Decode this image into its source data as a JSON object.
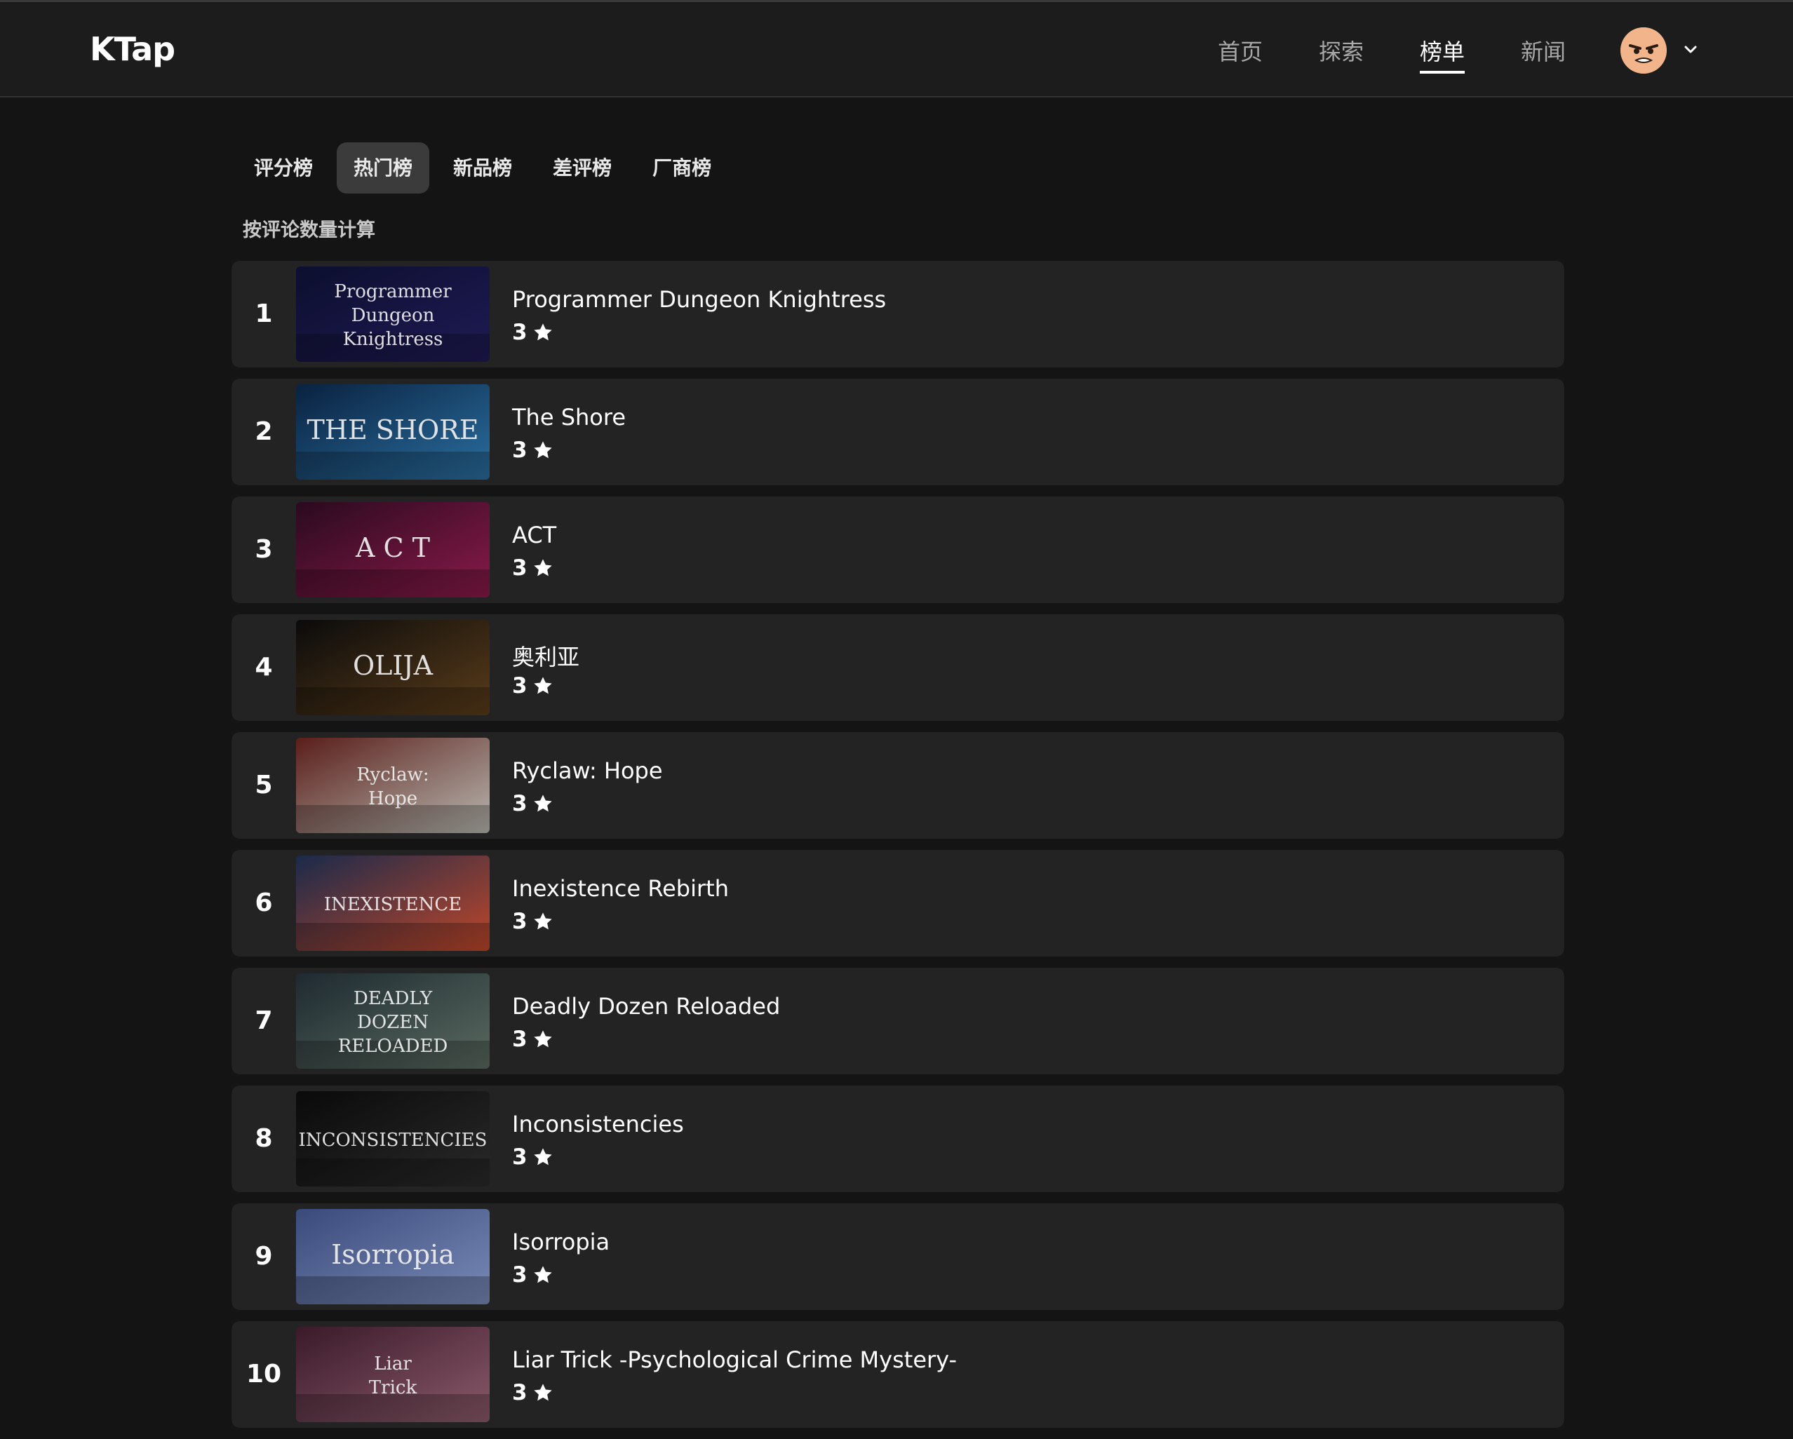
{
  "header": {
    "logo": "KTap",
    "nav": [
      {
        "label": "首页",
        "active": false
      },
      {
        "label": "探索",
        "active": false
      },
      {
        "label": "榜单",
        "active": true
      },
      {
        "label": "新闻",
        "active": false
      }
    ]
  },
  "tabs": [
    {
      "label": "评分榜",
      "active": false
    },
    {
      "label": "热门榜",
      "active": true
    },
    {
      "label": "新品榜",
      "active": false
    },
    {
      "label": "差评榜",
      "active": false
    },
    {
      "label": "厂商榜",
      "active": false
    }
  ],
  "subtitle": "按评论数量计算",
  "games": [
    {
      "rank": "1",
      "title": "Programmer Dungeon Knightress",
      "rating": "3",
      "thumb_text": [
        "Programmer",
        "Dungeon",
        "Knightress"
      ],
      "thumb_colors": [
        "#0c0f2e",
        "#1f1a55"
      ]
    },
    {
      "rank": "2",
      "title": "The Shore",
      "rating": "3",
      "thumb_text": [
        "THE SHORE"
      ],
      "thumb_colors": [
        "#0a2240",
        "#2a6fa0"
      ]
    },
    {
      "rank": "3",
      "title": "ACT",
      "rating": "3",
      "thumb_text": [
        "A C T"
      ],
      "thumb_colors": [
        "#2a0a1e",
        "#8a1a4a"
      ]
    },
    {
      "rank": "4",
      "title": "奥利亚",
      "rating": "3",
      "thumb_text": [
        "OLIJA"
      ],
      "thumb_colors": [
        "#0b0b0b",
        "#5a3c1a"
      ]
    },
    {
      "rank": "5",
      "title": "Ryclaw: Hope",
      "rating": "3",
      "thumb_text": [
        "Ryclaw:",
        "Hope"
      ],
      "thumb_colors": [
        "#5a1e1a",
        "#b8b8b0"
      ]
    },
    {
      "rank": "6",
      "title": "Inexistence Rebirth",
      "rating": "3",
      "thumb_text": [
        "INEXISTENCE"
      ],
      "thumb_colors": [
        "#1a2a4a",
        "#c0472a"
      ]
    },
    {
      "rank": "7",
      "title": "Deadly Dozen Reloaded",
      "rating": "3",
      "thumb_text": [
        "DEADLY",
        "DOZEN",
        "RELOADED"
      ],
      "thumb_colors": [
        "#1e2a30",
        "#5a6a60"
      ]
    },
    {
      "rank": "8",
      "title": "Inconsistencies",
      "rating": "3",
      "thumb_text": [
        "INCONSISTENCIES"
      ],
      "thumb_colors": [
        "#0a0a0a",
        "#2a2a2a"
      ]
    },
    {
      "rank": "9",
      "title": "Isorropia",
      "rating": "3",
      "thumb_text": [
        "Isorropia"
      ],
      "thumb_colors": [
        "#3a4a7a",
        "#7a8ab8"
      ]
    },
    {
      "rank": "10",
      "title": "Liar Trick -Psychological Crime Mystery-",
      "rating": "3",
      "thumb_text": [
        "Liar",
        "Trick"
      ],
      "thumb_colors": [
        "#3a1a2a",
        "#8a5a6a"
      ]
    }
  ]
}
